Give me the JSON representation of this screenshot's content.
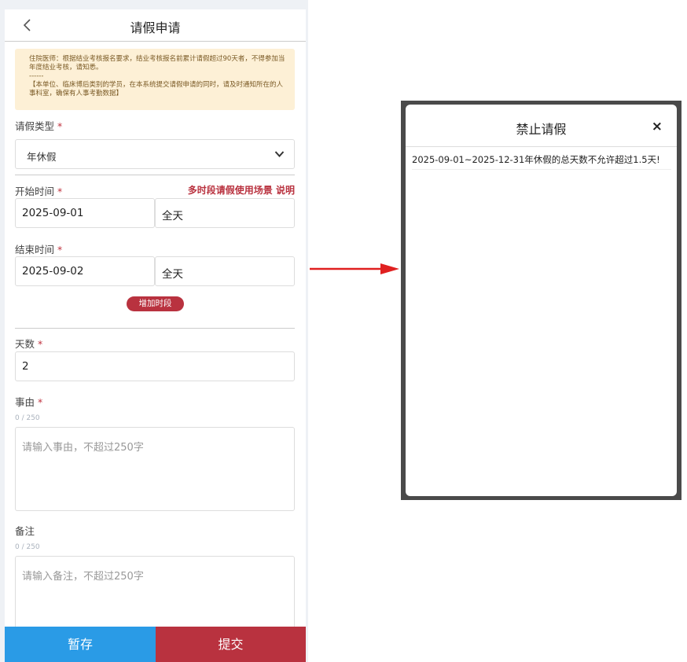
{
  "header": {
    "title": "请假申请",
    "back_icon": "chevron-left-icon"
  },
  "notice": {
    "text": "住院医师：根据结业考核报名要求，结业考核报名前累计请假超过90天者，不得参加当年度结业考核，请知悉。\n------\n【本单位、临床博后类别的学员，在本系统提交请假申请的同时，请及时通知所在的人事科室，确保有人事考勤数据】"
  },
  "form": {
    "leave_type": {
      "label": "请假类型",
      "required": "*",
      "value": "年休假"
    },
    "start": {
      "label": "开始时间",
      "required": "*",
      "date": "2025-09-01",
      "period": "全天"
    },
    "multi_period_link": "多时段请假使用场景",
    "explain_link": "说明",
    "end": {
      "label": "结束时间",
      "required": "*",
      "date": "2025-09-02",
      "period": "全天"
    },
    "add_period_button": "增加时段",
    "days": {
      "label": "天数",
      "required": "*",
      "value": "2"
    },
    "reason": {
      "label": "事由",
      "required": "*",
      "counter": "0 / 250",
      "placeholder": "请输入事由，不超过250字"
    },
    "remark": {
      "label": "备注",
      "counter": "0 / 250",
      "placeholder": "请输入备注，不超过250字"
    }
  },
  "footer": {
    "save_label": "暂存",
    "submit_label": "提交"
  },
  "modal": {
    "title": "禁止请假",
    "close": "×",
    "message": "2025-09-01~2025-12-31年休假的总天数不允许超过1.5天!"
  },
  "colors": {
    "accent_red": "#b9323f",
    "save_blue": "#2a9be6",
    "notice_bg": "#fdf0d6"
  }
}
